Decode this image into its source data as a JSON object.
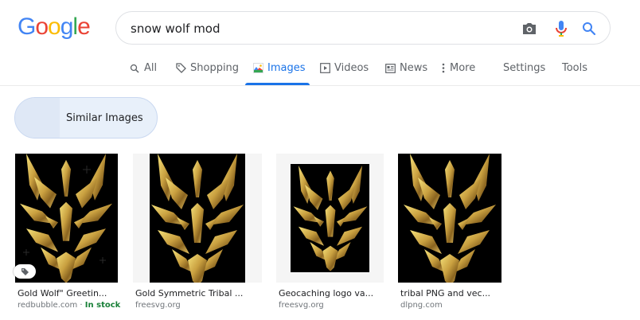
{
  "logo": {
    "letters": [
      "G",
      "o",
      "o",
      "g",
      "l",
      "e"
    ],
    "colors": [
      "#4285F4",
      "#EA4335",
      "#FBBC05",
      "#4285F4",
      "#34A853",
      "#EA4335"
    ]
  },
  "search": {
    "query": "snow wolf mod",
    "camera_icon": "camera-icon",
    "mic_icon": "mic-icon",
    "search_icon": "search-icon"
  },
  "tabs": [
    {
      "label": "All",
      "icon": "search-icon"
    },
    {
      "label": "Shopping",
      "icon": "tag-icon"
    },
    {
      "label": "Images",
      "icon": "image-icon"
    },
    {
      "label": "Videos",
      "icon": "play-icon"
    },
    {
      "label": "News",
      "icon": "news-icon"
    },
    {
      "label": "More",
      "icon": "more-icon"
    }
  ],
  "tools": {
    "settings": "Settings",
    "tools": "Tools"
  },
  "accent": "#1a73e8",
  "chip": {
    "label": "Similar Images"
  },
  "results": [
    {
      "title": "Gold Wolf\" Greetin...",
      "source": "redbubble.com",
      "sep": " · ",
      "stock": "In stock"
    },
    {
      "title": "Gold Symmetric Tribal ...",
      "source": "freesvg.org"
    },
    {
      "title": "Geocaching logo va...",
      "source": "freesvg.org"
    },
    {
      "title": "tribal PNG and vec...",
      "source": "dlpng.com"
    }
  ]
}
